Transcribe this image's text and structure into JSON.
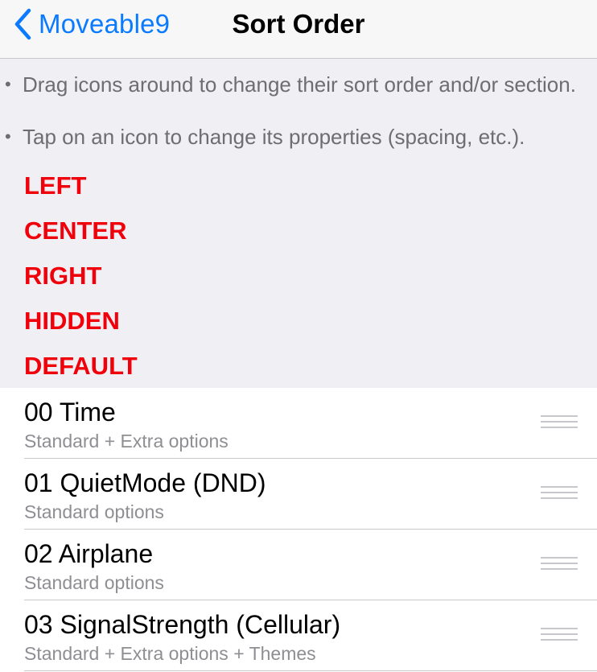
{
  "nav": {
    "back_label": "Moveable9",
    "title": "Sort Order"
  },
  "instructions": [
    "Drag icons around to change their sort order and/or section.",
    "Tap on an icon to change its properties (spacing, etc.)."
  ],
  "sections": [
    "LEFT",
    "CENTER",
    "RIGHT",
    "HIDDEN",
    "DEFAULT"
  ],
  "items": [
    {
      "title": "00 Time",
      "subtitle": "Standard + Extra options"
    },
    {
      "title": "01 QuietMode (DND)",
      "subtitle": "Standard options"
    },
    {
      "title": "02 Airplane",
      "subtitle": "Standard options"
    },
    {
      "title": "03 SignalStrength (Cellular)",
      "subtitle": "Standard + Extra options + Themes"
    }
  ],
  "colors": {
    "accent": "#0a7aff",
    "section_red": "#f0000a"
  },
  "icons": {
    "back": "chevron-left-icon",
    "reorder": "reorder-handle-icon"
  }
}
